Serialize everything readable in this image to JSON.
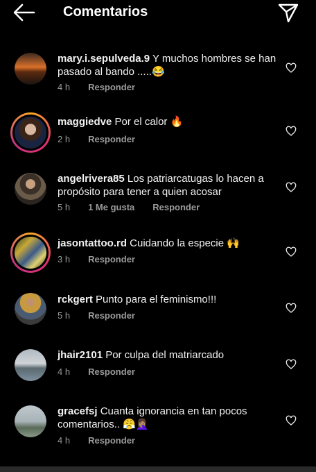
{
  "header": {
    "title": "Comentarios"
  },
  "comments": [
    {
      "user": "mary.i.sepulveda.9",
      "text": " Y  muchos hombres se han pasado al bando .....😂",
      "time": "4 h",
      "reply": "Responder"
    },
    {
      "user": "maggiedve",
      "text": " Por el calor 🔥",
      "time": "2 h",
      "reply": "Responder"
    },
    {
      "user": "angelrivera85",
      "text": " Los patriarcatugas lo hacen a propósito para tener a quien acosar",
      "time": "5 h",
      "likes": "1 Me gusta",
      "reply": "Responder"
    },
    {
      "user": "jasontattoo.rd",
      "text": " Cuidando la especie 🙌",
      "time": "3 h",
      "reply": "Responder"
    },
    {
      "user": "rckgert",
      "text": " Punto para el feminismo!!!",
      "time": "5 h",
      "reply": "Responder"
    },
    {
      "user": "jhair2101",
      "text": " Por culpa del matriarcado",
      "time": "4 h",
      "reply": "Responder"
    },
    {
      "user": "gracefsj",
      "text": " Cuanta ignorancia en tan pocos comentarios.. 😤🤦🏽‍♀️",
      "time": "4 h",
      "reply": "Responder"
    }
  ],
  "icons": {
    "back": "arrow-left-icon",
    "send": "paper-plane-icon",
    "like": "heart-outline-icon"
  }
}
